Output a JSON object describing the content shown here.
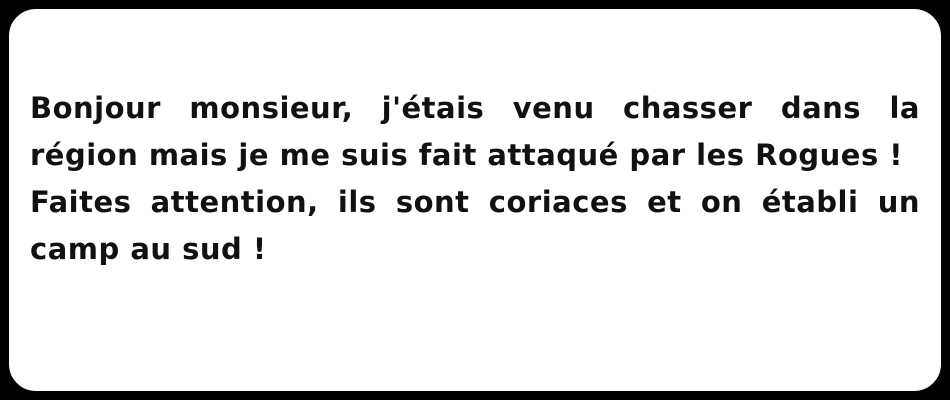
{
  "dialog": {
    "paragraphs": [
      "Bonjour monsieur, j'étais venu chasser dans la région mais je me suis fait attaqué par les Rogues !",
      "Faites attention, ils sont coriaces et on établi un camp au sud !"
    ]
  },
  "colors": {
    "background": "#ffffff",
    "border": "#000000",
    "text": "#111111"
  }
}
